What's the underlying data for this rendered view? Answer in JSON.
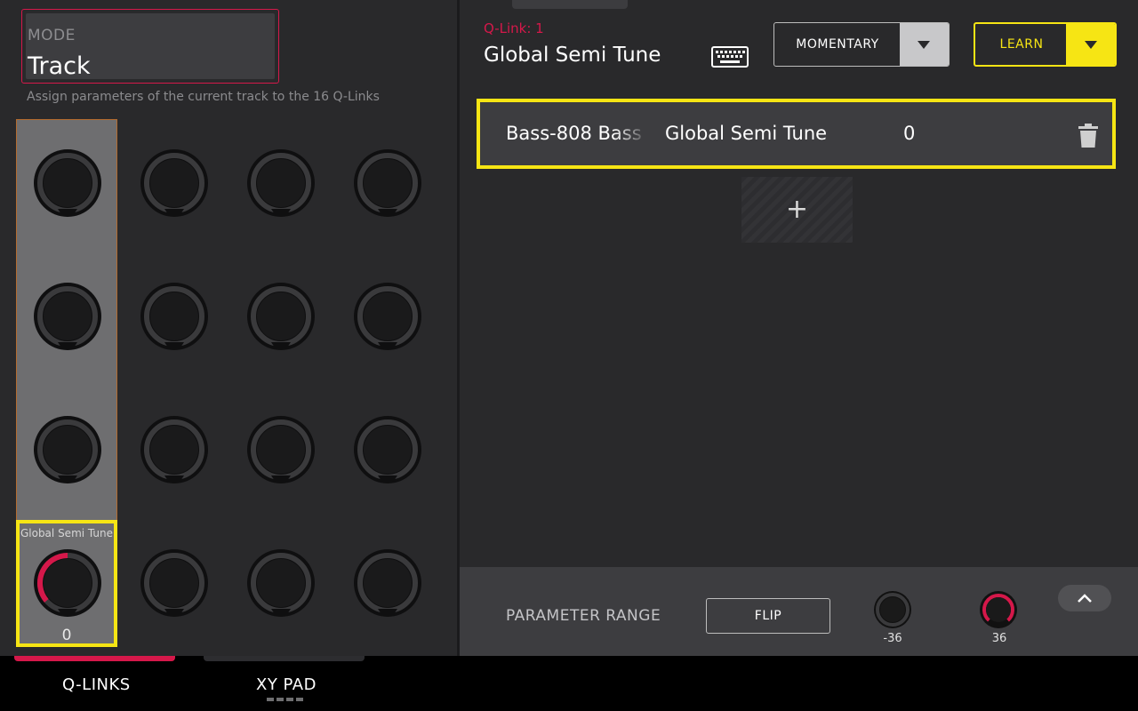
{
  "mode": {
    "label": "MODE",
    "value": "Track",
    "description": "Assign parameters of the current track to the 16 Q-Links"
  },
  "qlink_grid": {
    "selected": {
      "label": "Global Semi Tune",
      "value": "0",
      "level": 0.5
    }
  },
  "header": {
    "qlink_number": "Q-Link: 1",
    "parameter_name": "Global Semi Tune",
    "keyboard_icon": "keyboard-icon",
    "momentary_label": "MOMENTARY",
    "learn_label": "LEARN"
  },
  "assignment": {
    "track": "Bass-808 Bass",
    "parameter": "Global Semi Tune",
    "value": "0"
  },
  "add_button": "+",
  "parameter_range": {
    "label": "PARAMETER RANGE",
    "flip_label": "FLIP",
    "min_value": "-36",
    "max_value": "36"
  },
  "bottom_tabs": {
    "qlinks": "Q-LINKS",
    "xypad": "XY PAD"
  },
  "colors": {
    "accent_red": "#d5184a",
    "accent_yellow": "#f6e514",
    "panel_bg": "#29292b"
  }
}
